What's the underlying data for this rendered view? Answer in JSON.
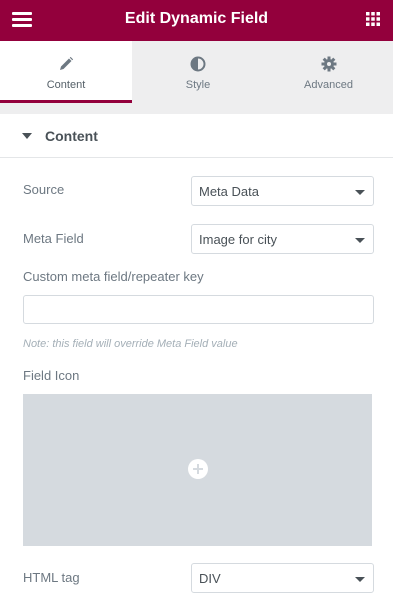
{
  "header": {
    "title": "Edit Dynamic Field",
    "menu_icon": "hamburger-menu-icon",
    "apps_icon": "grid-apps-icon",
    "brand_color": "#93003c"
  },
  "tabs": [
    {
      "label": "Content",
      "icon": "pencil-icon",
      "active": true
    },
    {
      "label": "Style",
      "icon": "half-circle-contrast-icon",
      "active": false
    },
    {
      "label": "Advanced",
      "icon": "gear-icon",
      "active": false
    }
  ],
  "section": {
    "title": "Content",
    "expanded": true
  },
  "fields": {
    "source": {
      "label": "Source",
      "value": "Meta Data"
    },
    "meta_field": {
      "label": "Meta Field",
      "value": "Image for city"
    },
    "custom_key": {
      "label": "Custom meta field/repeater key",
      "value": "",
      "placeholder": ""
    },
    "note": "Note: this field will override Meta Field value",
    "field_icon": {
      "label": "Field Icon",
      "icon": "plus-circle-icon"
    },
    "html_tag": {
      "label": "HTML tag",
      "value": "DIV"
    }
  }
}
